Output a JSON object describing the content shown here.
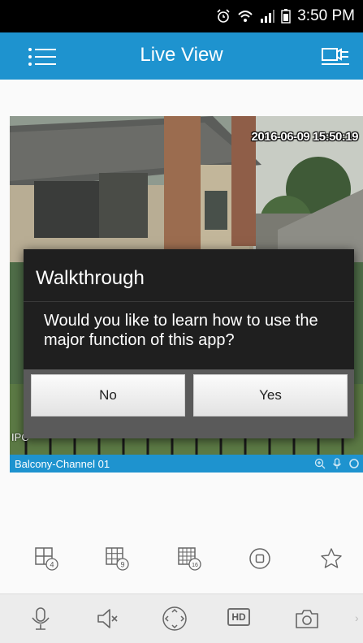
{
  "status_bar": {
    "time": "3:50 PM",
    "icons": [
      "alarm-icon",
      "wifi-icon",
      "signal-icon",
      "battery-icon"
    ]
  },
  "app_bar": {
    "title": "Live View",
    "menu_icon": "menu-list-icon",
    "device_icon": "device-list-icon",
    "color": "#1e93cf"
  },
  "video": {
    "timestamp": "2016-06-09 15:50:19",
    "ipc_label": "IPC",
    "channel_name": "Balcony-Channel 01",
    "channel_icons": [
      "zoom-icon",
      "mic-icon",
      "record-icon"
    ]
  },
  "dialog": {
    "title": "Walkthrough",
    "message": "Would you like to learn how to use the major function of this app?",
    "no_label": "No",
    "yes_label": "Yes"
  },
  "layout_buttons": [
    {
      "icon": "grid-4-icon",
      "label": "4"
    },
    {
      "icon": "grid-9-icon",
      "label": "9"
    },
    {
      "icon": "grid-16-icon",
      "label": "16"
    },
    {
      "icon": "stop-icon"
    },
    {
      "icon": "star-icon"
    }
  ],
  "controls": {
    "icons": [
      "microphone-icon",
      "mute-icon",
      "ptz-icon",
      "hd-icon",
      "camera-icon"
    ],
    "hd_label": "HD",
    "more_label": "›"
  }
}
